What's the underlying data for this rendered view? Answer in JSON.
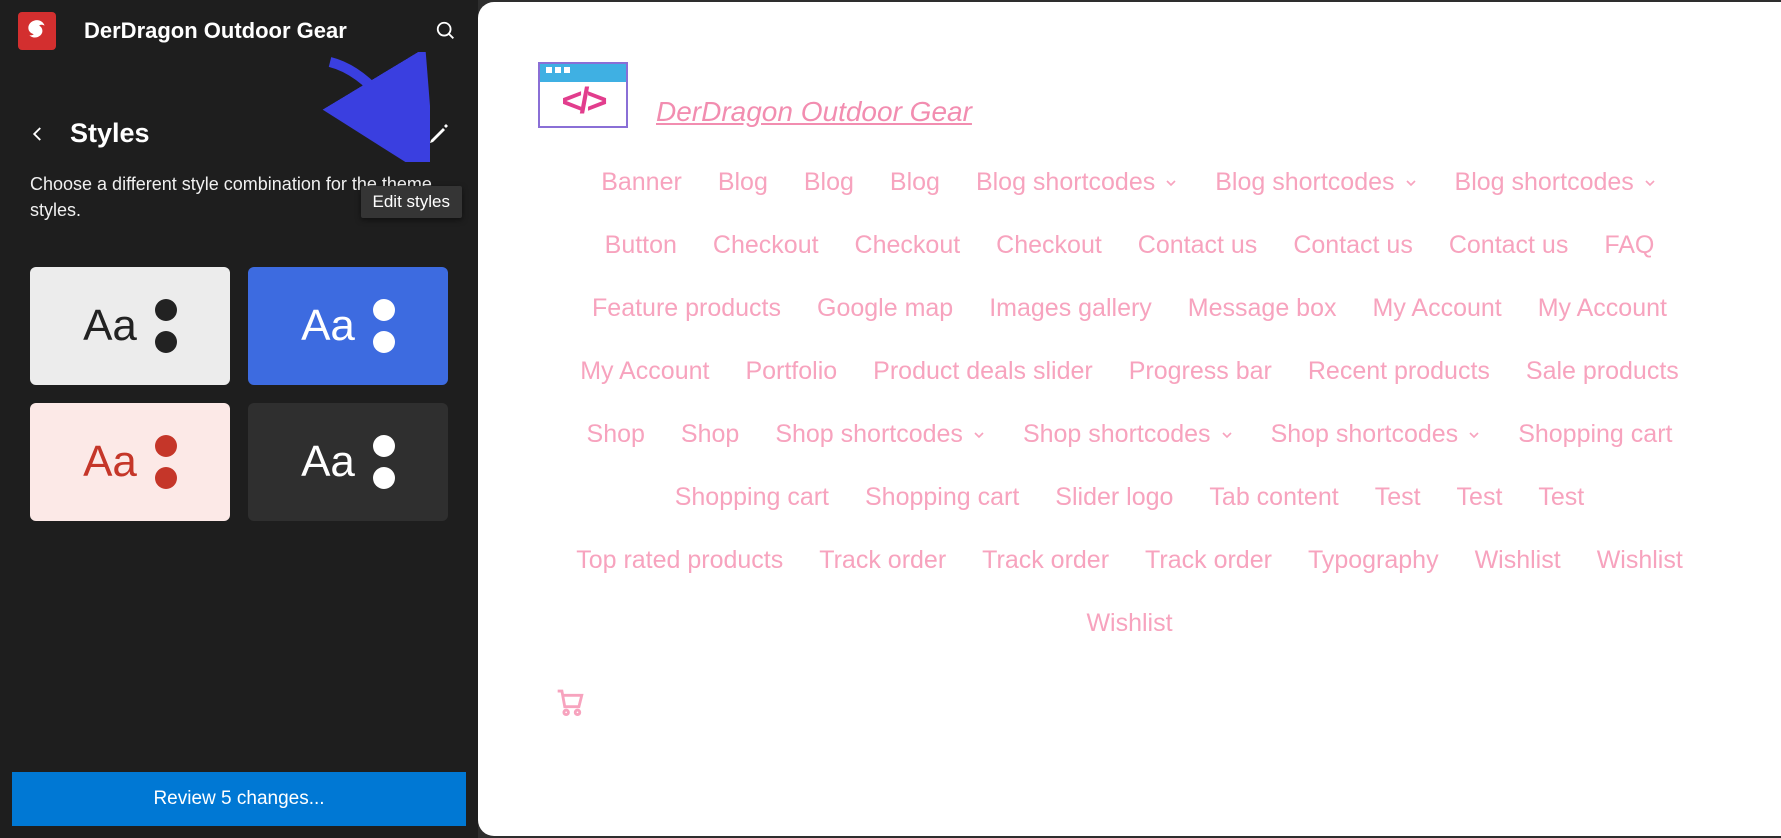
{
  "sidebar": {
    "site_title": "DerDragon Outdoor Gear",
    "panel_title": "Styles",
    "description": "Choose a different style combination for the theme styles.",
    "tooltip": "Edit styles",
    "style_cards": [
      {
        "variant": "light",
        "label": "Aa"
      },
      {
        "variant": "blue",
        "label": "Aa"
      },
      {
        "variant": "pink",
        "label": "Aa"
      },
      {
        "variant": "dark",
        "label": "Aa"
      }
    ],
    "review_button": "Review 5 changes..."
  },
  "preview": {
    "site_title": "DerDragon Outdoor Gear",
    "nav_items": [
      {
        "label": "Banner",
        "dropdown": false
      },
      {
        "label": "Blog",
        "dropdown": false
      },
      {
        "label": "Blog",
        "dropdown": false
      },
      {
        "label": "Blog",
        "dropdown": false
      },
      {
        "label": "Blog shortcodes",
        "dropdown": true
      },
      {
        "label": "Blog shortcodes",
        "dropdown": true
      },
      {
        "label": "Blog shortcodes",
        "dropdown": true
      },
      {
        "label": "Button",
        "dropdown": false
      },
      {
        "label": "Checkout",
        "dropdown": false
      },
      {
        "label": "Checkout",
        "dropdown": false
      },
      {
        "label": "Checkout",
        "dropdown": false
      },
      {
        "label": "Contact us",
        "dropdown": false
      },
      {
        "label": "Contact us",
        "dropdown": false
      },
      {
        "label": "Contact us",
        "dropdown": false
      },
      {
        "label": "FAQ",
        "dropdown": false
      },
      {
        "label": "Feature products",
        "dropdown": false
      },
      {
        "label": "Google map",
        "dropdown": false
      },
      {
        "label": "Images gallery",
        "dropdown": false
      },
      {
        "label": "Message box",
        "dropdown": false
      },
      {
        "label": "My Account",
        "dropdown": false
      },
      {
        "label": "My Account",
        "dropdown": false
      },
      {
        "label": "My Account",
        "dropdown": false
      },
      {
        "label": "Portfolio",
        "dropdown": false
      },
      {
        "label": "Product deals slider",
        "dropdown": false
      },
      {
        "label": "Progress bar",
        "dropdown": false
      },
      {
        "label": "Recent products",
        "dropdown": false
      },
      {
        "label": "Sale products",
        "dropdown": false
      },
      {
        "label": "Shop",
        "dropdown": false
      },
      {
        "label": "Shop",
        "dropdown": false
      },
      {
        "label": "Shop shortcodes",
        "dropdown": true
      },
      {
        "label": "Shop shortcodes",
        "dropdown": true
      },
      {
        "label": "Shop shortcodes",
        "dropdown": true
      },
      {
        "label": "Shopping cart",
        "dropdown": false
      },
      {
        "label": "Shopping cart",
        "dropdown": false
      },
      {
        "label": "Shopping cart",
        "dropdown": false
      },
      {
        "label": "Slider logo",
        "dropdown": false
      },
      {
        "label": "Tab content",
        "dropdown": false
      },
      {
        "label": "Test",
        "dropdown": false
      },
      {
        "label": "Test",
        "dropdown": false
      },
      {
        "label": "Test",
        "dropdown": false
      },
      {
        "label": "Top rated products",
        "dropdown": false
      },
      {
        "label": "Track order",
        "dropdown": false
      },
      {
        "label": "Track order",
        "dropdown": false
      },
      {
        "label": "Track order",
        "dropdown": false
      },
      {
        "label": "Typography",
        "dropdown": false
      },
      {
        "label": "Wishlist",
        "dropdown": false
      },
      {
        "label": "Wishlist",
        "dropdown": false
      },
      {
        "label": "Wishlist",
        "dropdown": false
      }
    ]
  }
}
